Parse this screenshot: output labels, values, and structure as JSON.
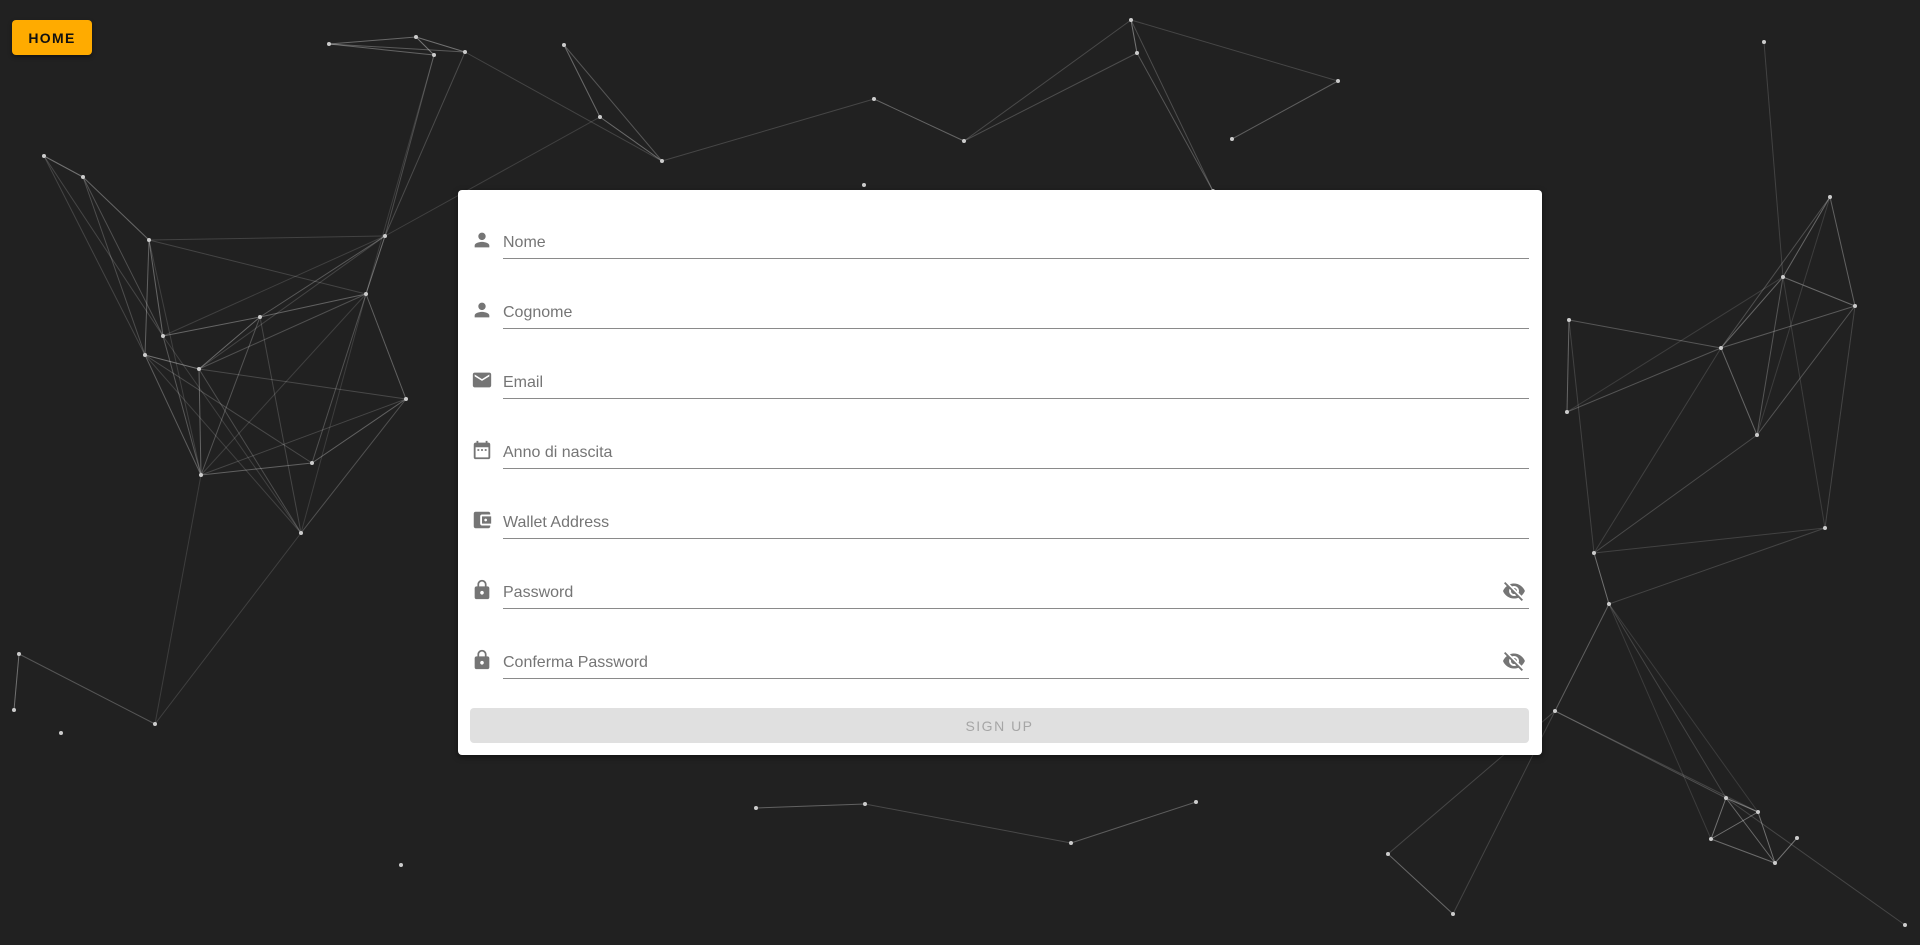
{
  "nav": {
    "home_label": "HOME"
  },
  "form": {
    "fields": [
      {
        "placeholder": "Nome",
        "icon": "person-icon"
      },
      {
        "placeholder": "Cognome",
        "icon": "person-icon"
      },
      {
        "placeholder": "Email",
        "icon": "email-icon"
      },
      {
        "placeholder": "Anno di nascita",
        "icon": "calendar-icon"
      },
      {
        "placeholder": "Wallet Address",
        "icon": "wallet-icon"
      },
      {
        "placeholder": "Password",
        "icon": "lock-icon"
      },
      {
        "placeholder": "Conferma Password",
        "icon": "lock-icon"
      }
    ],
    "submit_label": "SIGN UP"
  },
  "colors": {
    "background": "#212121",
    "accent": "#ffab00",
    "card": "#ffffff",
    "icon": "#757575"
  }
}
